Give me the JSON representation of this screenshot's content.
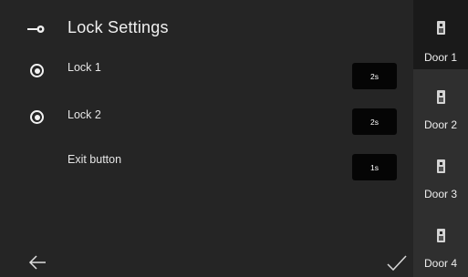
{
  "header": {
    "title": "Lock Settings",
    "icon": "key-icon"
  },
  "rows": [
    {
      "label": "Lock 1",
      "time": "2s",
      "selected": true
    },
    {
      "label": "Lock 2",
      "time": "2s",
      "selected": true
    },
    {
      "label": "Exit button",
      "time": "1s",
      "selected": false
    }
  ],
  "footer": {
    "back_icon": "arrow-left-icon",
    "confirm_icon": "checkmark-icon"
  },
  "sidebar": {
    "doors": [
      {
        "label": "Door 1",
        "active": true
      },
      {
        "label": "Door 2",
        "active": false
      },
      {
        "label": "Door 3",
        "active": false
      },
      {
        "label": "Door 4",
        "active": false
      }
    ]
  },
  "colors": {
    "background": "#252525",
    "sidebar": "#2f2f2f",
    "sidebar_active": "#1a1a1a",
    "time_box": "#050505",
    "text": "#e8e8e8"
  }
}
